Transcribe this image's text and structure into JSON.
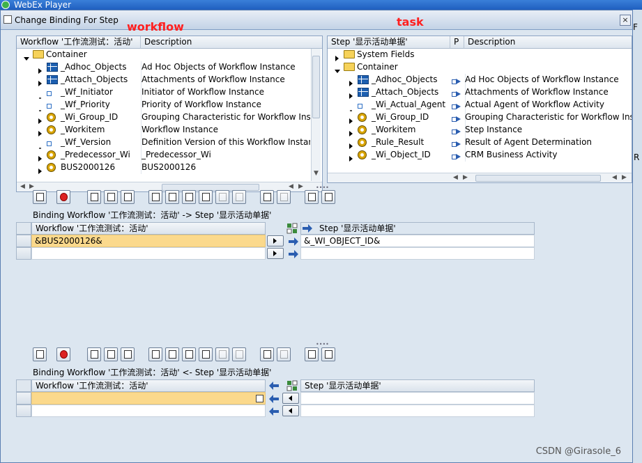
{
  "app_title": "WebEx Player",
  "dialog": {
    "title": "Change Binding For Step",
    "close": "×"
  },
  "annotations": {
    "workflow": "workflow",
    "task": "task"
  },
  "left_pane": {
    "col1": "Workflow '工作流测试：活动'",
    "col2": "Description",
    "container": "Container",
    "rows": [
      {
        "name": "_Adhoc_Objects",
        "desc": "Ad Hoc Objects of Workflow Instance",
        "icon": "table-icon",
        "expander": true
      },
      {
        "name": "_Attach_Objects",
        "desc": "Attachments of Workflow Instance",
        "icon": "table-icon",
        "expander": true
      },
      {
        "name": "_Wf_Initiator",
        "desc": "Initiator of Workflow Instance",
        "icon": "element-icon",
        "expander": false
      },
      {
        "name": "_Wf_Priority",
        "desc": "Priority of Workflow Instance",
        "icon": "element-icon",
        "expander": false
      },
      {
        "name": "_Wi_Group_ID",
        "desc": "Grouping Characteristic for Workflow Instanc",
        "icon": "object-icon",
        "expander": true
      },
      {
        "name": "_Workitem",
        "desc": "Workflow Instance",
        "icon": "object-icon",
        "expander": true
      },
      {
        "name": "_Wf_Version",
        "desc": "Definition Version of this Workflow Instance",
        "icon": "element-icon",
        "expander": false
      },
      {
        "name": "_Predecessor_Wi",
        "desc": "_Predecessor_Wi",
        "icon": "object-icon",
        "expander": true
      },
      {
        "name": "BUS2000126",
        "desc": "BUS2000126",
        "icon": "object-icon",
        "expander": true
      }
    ]
  },
  "right_pane": {
    "col1": "Step '显示活动单据'",
    "col2": "P",
    "col3": "Description",
    "system_fields": "System Fields",
    "container": "Container",
    "rows": [
      {
        "name": "_Adhoc_Objects",
        "desc": "Ad Hoc Objects of Workflow Instance",
        "icon": "table-icon",
        "expander": true,
        "bind": true
      },
      {
        "name": "_Attach_Objects",
        "desc": "Attachments of Workflow Instance",
        "icon": "table-icon",
        "expander": true,
        "bind": true
      },
      {
        "name": "_Wi_Actual_Agent",
        "desc": "Actual Agent of Workflow Activity",
        "icon": "element-icon",
        "expander": false,
        "bind": true
      },
      {
        "name": "_Wi_Group_ID",
        "desc": "Grouping Characteristic for Workflow Insta",
        "icon": "object-icon",
        "expander": true,
        "bind": true
      },
      {
        "name": "_Workitem",
        "desc": "Step Instance",
        "icon": "object-icon",
        "expander": true,
        "bind": true
      },
      {
        "name": "_Rule_Result",
        "desc": "Result of Agent Determination",
        "icon": "object-icon",
        "expander": true,
        "bind": true
      },
      {
        "name": "_Wi_Object_ID",
        "desc": "CRM Business Activity",
        "icon": "object-icon",
        "expander": true,
        "bind": true
      }
    ]
  },
  "binding_top": {
    "label": "Binding Workflow '工作流测试：活动' -> Step '显示活动单据'",
    "left_header": "Workflow '工作流测试：活动'",
    "right_header": "Step '显示活动单据'",
    "rows": [
      {
        "left": "&BUS2000126&",
        "right": "&_WI_OBJECT_ID&"
      },
      {
        "left": "",
        "right": ""
      }
    ]
  },
  "binding_bottom": {
    "label": "Binding Workflow '工作流测试：活动' <- Step '显示活动单据'",
    "left_header": "Workflow '工作流测试：活动'",
    "right_header": "Step '显示活动单据'",
    "rows": [
      {
        "left": "",
        "right": ""
      },
      {
        "left": "",
        "right": ""
      }
    ]
  },
  "right_strip": {
    "item1": "F",
    "item2": "R"
  },
  "watermark": "CSDN @Girasole_6",
  "colors": {
    "selected_row": "#fbd98c",
    "annotation": "#ff2020",
    "dialog_bg": "#dce6f0"
  }
}
